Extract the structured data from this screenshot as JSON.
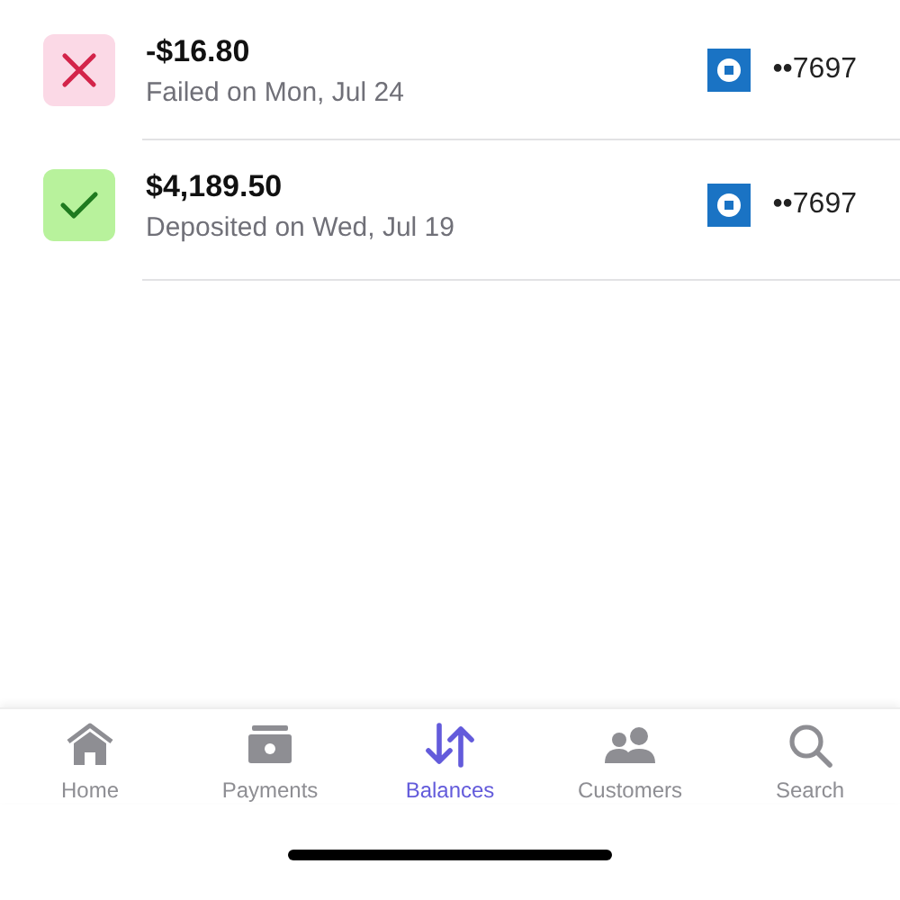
{
  "transactions": [
    {
      "kind": "failed",
      "amount": "-$16.80",
      "status": "Failed on Mon, Jul 24",
      "account": "••7697"
    },
    {
      "kind": "deposited",
      "amount": "$4,189.50",
      "status": "Deposited on Wed, Jul 19",
      "account": "••7697"
    }
  ],
  "tab_bar": [
    {
      "kind": "home",
      "label": "Home",
      "selected": false
    },
    {
      "kind": "payments",
      "label": "Payments",
      "selected": false
    },
    {
      "kind": "balances",
      "label": "Balances",
      "selected": true
    },
    {
      "kind": "customers",
      "label": "Customers",
      "selected": false
    },
    {
      "kind": "search",
      "label": "Search",
      "selected": false
    }
  ]
}
